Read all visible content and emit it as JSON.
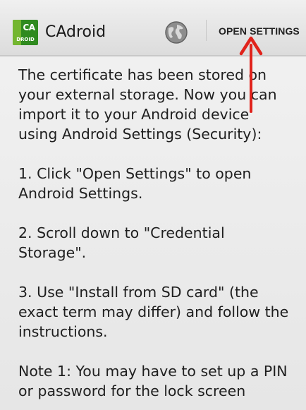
{
  "app": {
    "title": "CAdroid",
    "icon_top": "CA",
    "icon_bottom": "DROID"
  },
  "action_bar": {
    "globe_icon": "globe-icon",
    "open_settings_label": "OPEN SETTINGS"
  },
  "content": {
    "paragraphs": [
      "The certificate has been stored on\nyour external storage. Now you can\nimport it to your Android device\nusing Android Settings (Security):",
      "1. Click \"Open Settings\" to open\nAndroid Settings.",
      "2. Scroll down to \"Credential\nStorage\".",
      "3. Use \"Install from SD card\" (the\nexact term may differ) and follow the\ninstructions.",
      "Note 1: You may have to set up a PIN\nor password for the lock screen"
    ]
  },
  "colors": {
    "annotation_arrow": "#e0231c",
    "icon_green": "#2f8a1f"
  }
}
